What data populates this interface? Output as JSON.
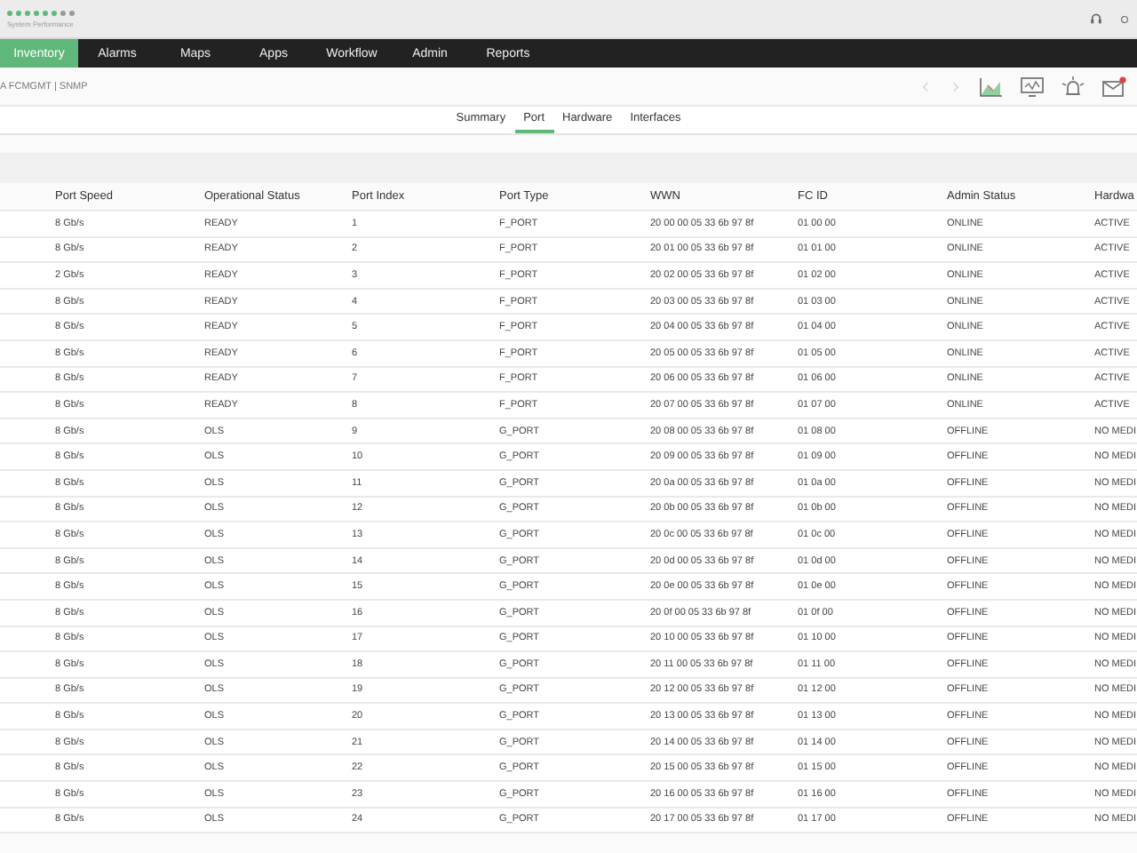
{
  "brand": {
    "subtitle": "System Performance",
    "dots": [
      {
        "color": "#5fb87a"
      },
      {
        "color": "#5fb87a"
      },
      {
        "color": "#5fb87a"
      },
      {
        "color": "#5fb87a"
      },
      {
        "color": "#5fb87a"
      },
      {
        "color": "#5fb87a"
      },
      {
        "color": "#9a9a9a"
      },
      {
        "color": "#9a9a9a"
      }
    ]
  },
  "nav": [
    {
      "label": "Inventory",
      "selected": true
    },
    {
      "label": "Alarms",
      "selected": false
    },
    {
      "label": "Maps",
      "selected": false
    },
    {
      "label": "Apps",
      "selected": false
    },
    {
      "label": "Workflow",
      "selected": false
    },
    {
      "label": "Admin",
      "selected": false
    },
    {
      "label": "Reports",
      "selected": false
    }
  ],
  "breadcrumb": "A FCMGMT | SNMP",
  "subtabs": [
    {
      "label": "Summary",
      "selected": false
    },
    {
      "label": "Port",
      "selected": true
    },
    {
      "label": "Hardware",
      "selected": false
    },
    {
      "label": "Interfaces",
      "selected": false
    }
  ],
  "table": {
    "columns": [
      "Port Speed",
      "Operational Status",
      "Port Index",
      "Port Type",
      "WWN",
      "FC ID",
      "Admin Status",
      "Hardwa"
    ],
    "rows": [
      [
        "8 Gb/s",
        "READY",
        "1",
        "F_PORT",
        "20 00 00 05 33 6b 97 8f",
        "01 00 00",
        "ONLINE",
        "ACTIVE"
      ],
      [
        "8 Gb/s",
        "READY",
        "2",
        "F_PORT",
        "20 01 00 05 33 6b 97 8f",
        "01 01 00",
        "ONLINE",
        "ACTIVE"
      ],
      [
        "2 Gb/s",
        "READY",
        "3",
        "F_PORT",
        "20 02 00 05 33 6b 97 8f",
        "01 02 00",
        "ONLINE",
        "ACTIVE"
      ],
      [
        "8 Gb/s",
        "READY",
        "4",
        "F_PORT",
        "20 03 00 05 33 6b 97 8f",
        "01 03 00",
        "ONLINE",
        "ACTIVE"
      ],
      [
        "8 Gb/s",
        "READY",
        "5",
        "F_PORT",
        "20 04 00 05 33 6b 97 8f",
        "01 04 00",
        "ONLINE",
        "ACTIVE"
      ],
      [
        "8 Gb/s",
        "READY",
        "6",
        "F_PORT",
        "20 05 00 05 33 6b 97 8f",
        "01 05 00",
        "ONLINE",
        "ACTIVE"
      ],
      [
        "8 Gb/s",
        "READY",
        "7",
        "F_PORT",
        "20 06 00 05 33 6b 97 8f",
        "01 06 00",
        "ONLINE",
        "ACTIVE"
      ],
      [
        "8 Gb/s",
        "READY",
        "8",
        "F_PORT",
        "20 07 00 05 33 6b 97 8f",
        "01 07 00",
        "ONLINE",
        "ACTIVE"
      ],
      [
        "8 Gb/s",
        "OLS",
        "9",
        "G_PORT",
        "20 08 00 05 33 6b 97 8f",
        "01 08 00",
        "OFFLINE",
        "NO MEDI"
      ],
      [
        "8 Gb/s",
        "OLS",
        "10",
        "G_PORT",
        "20 09 00 05 33 6b 97 8f",
        "01 09 00",
        "OFFLINE",
        "NO MEDI"
      ],
      [
        "8 Gb/s",
        "OLS",
        "11",
        "G_PORT",
        "20 0a 00 05 33 6b 97 8f",
        "01 0a 00",
        "OFFLINE",
        "NO MEDI"
      ],
      [
        "8 Gb/s",
        "OLS",
        "12",
        "G_PORT",
        "20 0b 00 05 33 6b 97 8f",
        "01 0b 00",
        "OFFLINE",
        "NO MEDI"
      ],
      [
        "8 Gb/s",
        "OLS",
        "13",
        "G_PORT",
        "20 0c 00 05 33 6b 97 8f",
        "01 0c 00",
        "OFFLINE",
        "NO MEDI"
      ],
      [
        "8 Gb/s",
        "OLS",
        "14",
        "G_PORT",
        "20 0d 00 05 33 6b 97 8f",
        "01 0d 00",
        "OFFLINE",
        "NO MEDI"
      ],
      [
        "8 Gb/s",
        "OLS",
        "15",
        "G_PORT",
        "20 0e 00 05 33 6b 97 8f",
        "01 0e 00",
        "OFFLINE",
        "NO MEDI"
      ],
      [
        "8 Gb/s",
        "OLS",
        "16",
        "G_PORT",
        "20 0f 00 05 33 6b 97 8f",
        "01 0f 00",
        "OFFLINE",
        "NO MEDI"
      ],
      [
        "8 Gb/s",
        "OLS",
        "17",
        "G_PORT",
        "20 10 00 05 33 6b 97 8f",
        "01 10 00",
        "OFFLINE",
        "NO MEDI"
      ],
      [
        "8 Gb/s",
        "OLS",
        "18",
        "G_PORT",
        "20 11 00 05 33 6b 97 8f",
        "01 11 00",
        "OFFLINE",
        "NO MEDI"
      ],
      [
        "8 Gb/s",
        "OLS",
        "19",
        "G_PORT",
        "20 12 00 05 33 6b 97 8f",
        "01 12 00",
        "OFFLINE",
        "NO MEDI"
      ],
      [
        "8 Gb/s",
        "OLS",
        "20",
        "G_PORT",
        "20 13 00 05 33 6b 97 8f",
        "01 13 00",
        "OFFLINE",
        "NO MEDI"
      ],
      [
        "8 Gb/s",
        "OLS",
        "21",
        "G_PORT",
        "20 14 00 05 33 6b 97 8f",
        "01 14 00",
        "OFFLINE",
        "NO MEDI"
      ],
      [
        "8 Gb/s",
        "OLS",
        "22",
        "G_PORT",
        "20 15 00 05 33 6b 97 8f",
        "01 15 00",
        "OFFLINE",
        "NO MEDI"
      ],
      [
        "8 Gb/s",
        "OLS",
        "23",
        "G_PORT",
        "20 16 00 05 33 6b 97 8f",
        "01 16 00",
        "OFFLINE",
        "NO MEDI"
      ],
      [
        "8 Gb/s",
        "OLS",
        "24",
        "G_PORT",
        "20 17 00 05 33 6b 97 8f",
        "01 17 00",
        "OFFLINE",
        "NO MEDI"
      ]
    ]
  }
}
